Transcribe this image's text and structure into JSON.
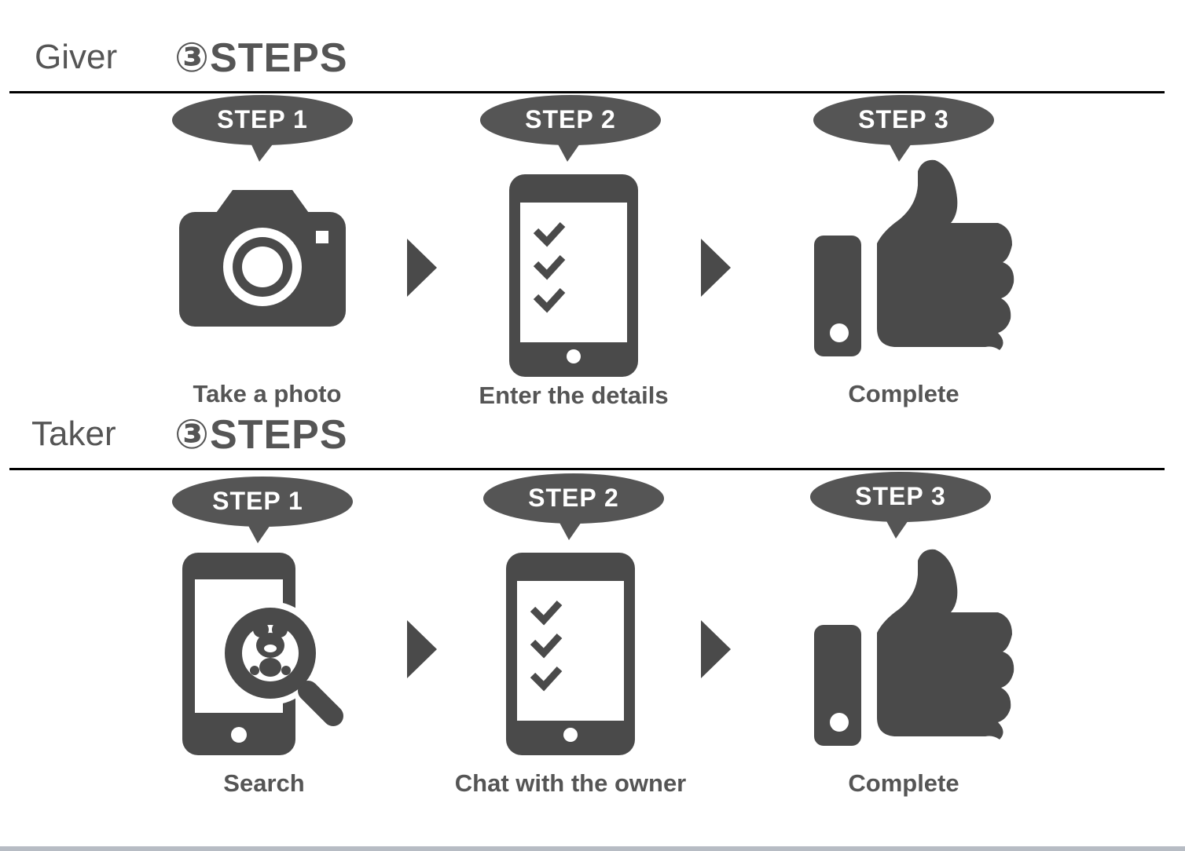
{
  "colors": {
    "icon": "#4a4a4a",
    "bubble": "#555555",
    "text": "#555555",
    "rule": "#000000"
  },
  "giver": {
    "role": "Giver",
    "title": "③STEPS",
    "steps": [
      {
        "badge": "STEP 1",
        "caption": "Take a photo",
        "icon": "camera-icon"
      },
      {
        "badge": "STEP 2",
        "caption": "Enter the details",
        "icon": "checklist-phone-icon"
      },
      {
        "badge": "STEP 3",
        "caption": "Complete",
        "icon": "thumbs-up-icon"
      }
    ]
  },
  "taker": {
    "role": "Taker",
    "title": "③STEPS",
    "steps": [
      {
        "badge": "STEP 1",
        "caption": "Search",
        "icon": "phone-search-icon"
      },
      {
        "badge": "STEP 2",
        "caption": "Chat with the owner",
        "icon": "checklist-phone-icon"
      },
      {
        "badge": "STEP 3",
        "caption": "Complete",
        "icon": "thumbs-up-icon"
      }
    ]
  }
}
